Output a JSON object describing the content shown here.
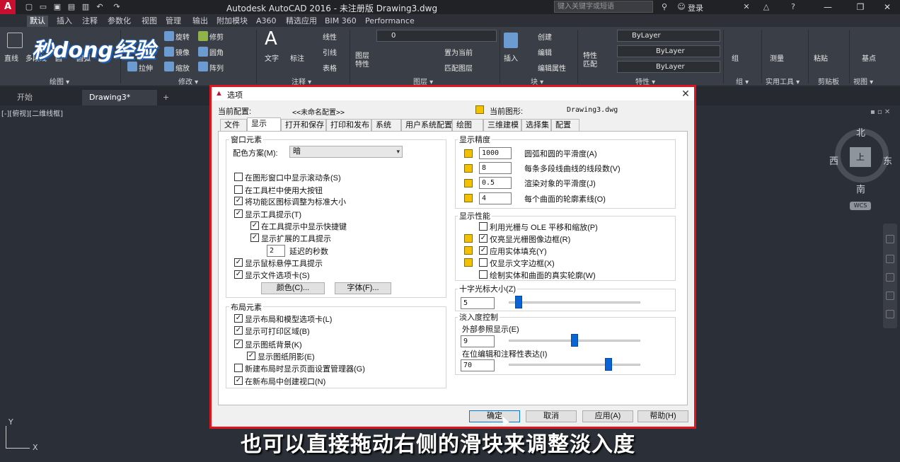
{
  "title_bar": {
    "app_logo": "A",
    "window_title": "Autodesk AutoCAD 2016 - 未注册版    Drawing3.dwg",
    "search_placeholder": "键入关键字或短语",
    "login": "登录",
    "minimize": "—",
    "restore": "❐",
    "close": "✕"
  },
  "ribbon_tabs": [
    "默认",
    "插入",
    "注释",
    "参数化",
    "视图",
    "管理",
    "输出",
    "附加模块",
    "A360",
    "精选应用",
    "BIM 360",
    "Performance"
  ],
  "ribbon": {
    "draw": {
      "title": "绘图 ▾",
      "line": "直线",
      "polyline": "多段线",
      "circle": "圆",
      "arc": "圆弧"
    },
    "modify": {
      "title": "修改 ▾",
      "rotate": "旋转",
      "trim": "修剪",
      "mirror": "镜像",
      "fillet": "圆角",
      "stretch": "拉伸",
      "scale": "缩放",
      "array": "阵列"
    },
    "annotation": {
      "title": "注释 ▾",
      "text": "文字",
      "dimension": "标注",
      "linear": "线性",
      "leader": "引线",
      "table": "表格"
    },
    "layers": {
      "title": "图层 ▾",
      "layer_props": "图层\n特性",
      "layer_combo": "0",
      "make_current": "置为当前",
      "match_layer": "匹配图层"
    },
    "block": {
      "title": "块 ▾",
      "insert": "插入",
      "create": "创建",
      "edit": "编辑",
      "edit_attr": "编辑属性"
    },
    "properties": {
      "title": "特性 ▾",
      "match": "特性\n匹配",
      "color": "ByLayer",
      "linetype": "ByLayer",
      "lineweight": "ByLayer"
    },
    "groups": {
      "title": "组 ▾",
      "group": "组"
    },
    "utilities": {
      "title": "实用工具 ▾",
      "measure": "测量"
    },
    "clipboard": {
      "title": "剪贴板",
      "paste": "粘贴"
    },
    "view": {
      "title": "视图 ▾",
      "base": "基点"
    }
  },
  "watermark": "秒dong经验",
  "file_tabs": {
    "start": "开始",
    "drawing": "Drawing3*",
    "add": "+"
  },
  "viewport": {
    "label": "[-][俯视][二维线框]",
    "controls": "▪ ▫ ✕",
    "compass": {
      "north": "北",
      "south": "南",
      "east": "东",
      "west": "西"
    },
    "viewcube_top": "上",
    "wcs": "WCS",
    "ucs_x": "X",
    "ucs_y": "Y"
  },
  "dialog": {
    "title": "选项",
    "current_profile_label": "当前配置:",
    "current_profile_value": "<<未命名配置>>",
    "current_drawing_label": "当前图形:",
    "current_drawing_value": "Drawing3.dwg",
    "tabs": [
      "文件",
      "显示",
      "打开和保存",
      "打印和发布",
      "系统",
      "用户系统配置",
      "绘图",
      "三维建模",
      "选择集",
      "配置"
    ],
    "window_elements": {
      "title": "窗口元素",
      "color_scheme_label": "配色方案(M):",
      "color_scheme_value": "暗",
      "checkboxes": [
        {
          "label": "在图形窗口中显示滚动条(S)",
          "checked": false
        },
        {
          "label": "在工具栏中使用大按钮",
          "checked": false
        },
        {
          "label": "将功能区图标调整为标准大小",
          "checked": true
        },
        {
          "label": "显示工具提示(T)",
          "checked": true
        },
        {
          "label": "在工具提示中显示快捷键",
          "checked": true
        },
        {
          "label": "显示扩展的工具提示",
          "checked": true
        },
        {
          "label": "显示鼠标悬停工具提示",
          "checked": true
        },
        {
          "label": "显示文件选项卡(S)",
          "checked": true
        }
      ],
      "delay_value": "2",
      "delay_label": "延迟的秒数",
      "colors_button": "颜色(C)...",
      "fonts_button": "字体(F)..."
    },
    "layout_elements": {
      "title": "布局元素",
      "checkboxes": [
        {
          "label": "显示布局和模型选项卡(L)",
          "checked": true
        },
        {
          "label": "显示可打印区域(B)",
          "checked": true
        },
        {
          "label": "显示图纸背景(K)",
          "checked": true
        },
        {
          "label": "显示图纸阴影(E)",
          "checked": true
        },
        {
          "label": "新建布局时显示页面设置管理器(G)",
          "checked": false
        },
        {
          "label": "在新布局中创建视口(N)",
          "checked": true
        }
      ]
    },
    "display_resolution": {
      "title": "显示精度",
      "rows": [
        {
          "value": "1000",
          "label": "圆弧和圆的平滑度(A)"
        },
        {
          "value": "8",
          "label": "每条多段线曲线的线段数(V)"
        },
        {
          "value": "0.5",
          "label": "渲染对象的平滑度(J)"
        },
        {
          "value": "4",
          "label": "每个曲面的轮廓素线(O)"
        }
      ]
    },
    "display_performance": {
      "title": "显示性能",
      "checkboxes": [
        {
          "label": "利用光栅与 OLE 平移和缩放(P)",
          "checked": false
        },
        {
          "label": "仅亮显光栅图像边框(R)",
          "checked": true
        },
        {
          "label": "应用实体填充(Y)",
          "checked": true
        },
        {
          "label": "仅显示文字边框(X)",
          "checked": false
        },
        {
          "label": "绘制实体和曲面的真实轮廓(W)",
          "checked": false
        }
      ]
    },
    "crosshair": {
      "title": "十字光标大小(Z)",
      "value": "5",
      "slider": 0.05
    },
    "fade": {
      "title": "淡入度控制",
      "xref_label": "外部参照显示(E)",
      "xref_value": "9",
      "xref_slider": 0.5,
      "inplace_label": "在位编辑和注释性表达(I)",
      "inplace_value": "70",
      "inplace_slider": 0.77
    },
    "buttons": {
      "ok": "确定",
      "cancel": "取消",
      "apply": "应用(A)",
      "help": "帮助(H)"
    }
  },
  "caption": "也可以直接拖动右侧的滑块来调整淡入度",
  "colors": {
    "highlight_border": "#e0141c",
    "slider_thumb": "#0a64d6",
    "ribbon_bg": "#3a3f47"
  }
}
